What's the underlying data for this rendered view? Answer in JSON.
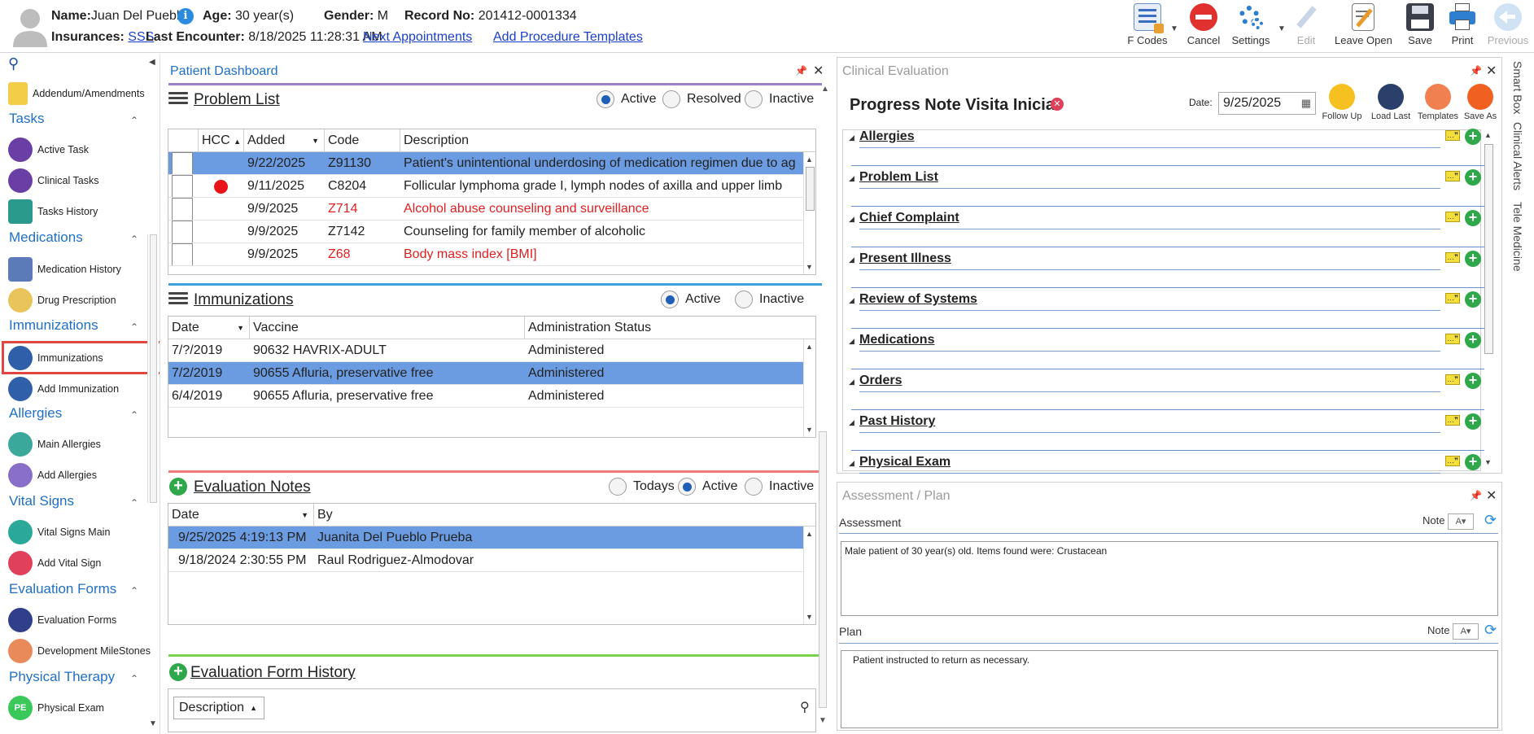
{
  "patient": {
    "name_label": "Name:",
    "name": "Juan Del Pueblo",
    "age_label": "Age:",
    "age": "30 year(s)",
    "gender_label": "Gender:",
    "gender": "M",
    "record_label": "Record No:",
    "record": "201412-0001334",
    "insurances_label": "Insurances:",
    "insurance": "SSS",
    "last_encounter_label": "Last Encounter:",
    "last_encounter": "8/18/2025 11:28:31 AM",
    "next_appointments": "Next Appointments",
    "add_procedure_templates": "Add Procedure Templates"
  },
  "toolbar": {
    "fcodes": "F Codes",
    "cancel": "Cancel",
    "settings": "Settings",
    "edit": "Edit",
    "leave_open": "Leave Open",
    "save": "Save",
    "print": "Print",
    "previous": "Previous"
  },
  "sidebar": {
    "addendum": "Addendum/Amendments",
    "tasks": "Tasks",
    "active_task": "Active Task",
    "clinical_tasks": "Clinical Tasks",
    "tasks_history": "Tasks History",
    "medications": "Medications",
    "medication_history": "Medication History",
    "drug_prescription": "Drug Prescription",
    "immunizations_section": "Immunizations",
    "immunizations": "Immunizations",
    "add_immunization": "Add Immunization",
    "allergies": "Allergies",
    "main_allergies": "Main Allergies",
    "add_allergies": "Add Allergies",
    "vital_signs": "Vital Signs",
    "vital_signs_main": "Vital Signs Main",
    "add_vital_sign": "Add Vital Sign",
    "evaluation_forms_section": "Evaluation Forms",
    "evaluation_forms": "Evaluation Forms",
    "development_milestones": "Development MileStones",
    "physical_therapy": "Physical Therapy",
    "physical_exam": "Physical Exam",
    "pe_badge": "PE"
  },
  "dashboard": {
    "title": "Patient Dashboard",
    "problem_list": {
      "title": "Problem List",
      "filters": [
        "Active",
        "Resolved",
        "Inactive"
      ],
      "active_filter": "Active",
      "headers": [
        "HCC",
        "Added",
        "Code",
        "Description"
      ],
      "rows": [
        {
          "added": "9/22/2025",
          "code": "Z91130",
          "desc": "Patient's unintentional underdosing of medication regimen due to ag",
          "red": false,
          "hcc": false
        },
        {
          "added": "9/11/2025",
          "code": "C8204",
          "desc": "Follicular lymphoma grade I, lymph nodes of axilla and upper limb",
          "red": false,
          "hcc": true
        },
        {
          "added": "9/9/2025",
          "code": "Z714",
          "desc": "Alcohol abuse counseling and surveillance",
          "red": true,
          "hcc": false
        },
        {
          "added": "9/9/2025",
          "code": "Z7142",
          "desc": "Counseling for family member of alcoholic",
          "red": false,
          "hcc": false
        },
        {
          "added": "9/9/2025",
          "code": "Z68",
          "desc": "Body mass index [BMI]",
          "red": true,
          "hcc": false
        }
      ]
    },
    "immunizations": {
      "title": "Immunizations",
      "filters": [
        "Active",
        "Inactive"
      ],
      "headers": [
        "Date",
        "Vaccine",
        "Administration Status"
      ],
      "rows": [
        {
          "date": "7/?/2019",
          "vaccine": "90632 HAVRIX-ADULT",
          "status": "Administered"
        },
        {
          "date": "7/2/2019",
          "vaccine": "90655 Afluria, preservative free",
          "status": "Administered"
        },
        {
          "date": "6/4/2019",
          "vaccine": "90655 Afluria, preservative free",
          "status": "Administered"
        }
      ]
    },
    "evaluation_notes": {
      "title": "Evaluation Notes",
      "filters": [
        "Todays",
        "Active",
        "Inactive"
      ],
      "headers": [
        "Date",
        "By"
      ],
      "rows": [
        {
          "date": "9/25/2025 4:19:13 PM",
          "by": "Juanita Del Pueblo Prueba"
        },
        {
          "date": "9/18/2024 2:30:55 PM",
          "by": "Raul Rodriguez-Almodovar"
        }
      ]
    },
    "evaluation_form_history": {
      "title": "Evaluation Form History",
      "description_header": "Description"
    }
  },
  "clinical": {
    "title": "Clinical Evaluation",
    "note_title": "Progress Note Visita Inicial",
    "date_label": "Date:",
    "date": "9/25/2025",
    "actions": [
      "Follow Up",
      "Load Last",
      "Templates",
      "Save As"
    ],
    "sections": [
      "Allergies",
      "Problem List",
      "Chief Complaint",
      "Present Illness",
      "Review of Systems",
      "Medications",
      "Orders",
      "Past History",
      "Physical Exam"
    ]
  },
  "assessment_plan": {
    "title": "Assessment / Plan",
    "assessment_label": "Assessment",
    "note_label": "Note",
    "assessment_text": "Male patient of 30 year(s) old. Items found were:  Crustacean",
    "plan_label": "Plan",
    "plan_text": "Patient instructed to return as necessary."
  },
  "right_tabs": [
    "Smart Box",
    "Clinical Alerts",
    "Tele Medicine"
  ],
  "colors": {
    "accent": "#1f6fc6",
    "selected_row": "#6b9be0",
    "problem_bar": "#9a82c8",
    "immun_bar": "#3ba1d8",
    "eval_bar": "#f07a7a",
    "history_bar": "#7ad14a",
    "highlight": "#e0453e"
  }
}
